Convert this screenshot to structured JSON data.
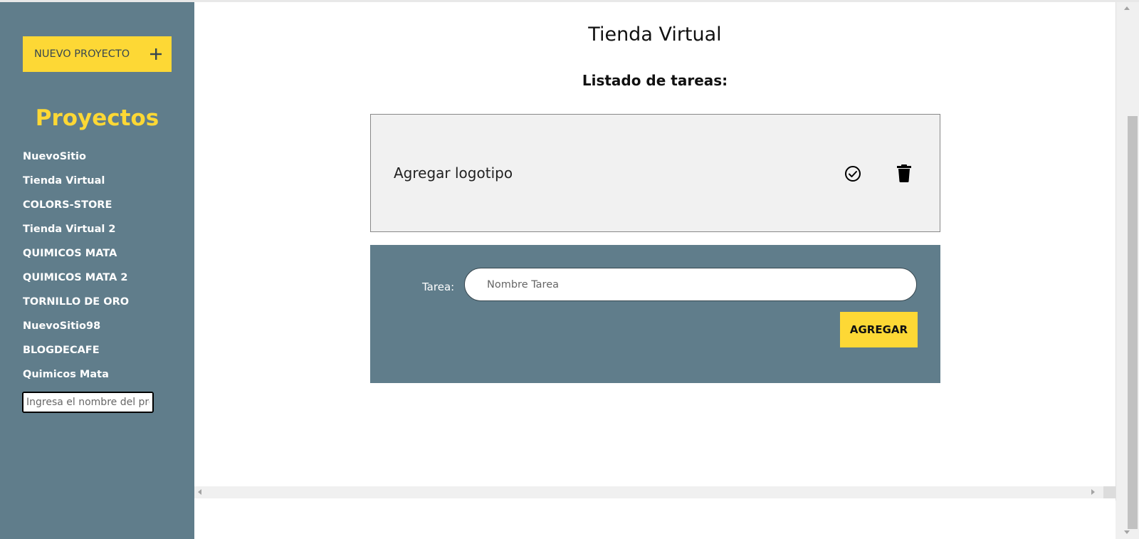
{
  "sidebar": {
    "new_project_label": "NUEVO PROYECTO",
    "new_project_icon": "plus-icon",
    "title": "Proyectos",
    "projects": [
      "NuevoSitio",
      "Tienda Virtual",
      "COLORS-STORE",
      "Tienda Virtual 2",
      "QUIMICOS MATA",
      "QUIMICOS MATA 2",
      "TORNILLO DE ORO",
      "NuevoSitio98",
      "BLOGDECAFE",
      "Quimicos Mata"
    ],
    "project_input_placeholder": "Ingresa el nombre del proyecto"
  },
  "main": {
    "title": "Tienda Virtual",
    "list_title": "Listado de tareas:",
    "tasks": [
      {
        "name": "Agregar logotipo",
        "complete_icon": "check-circle-icon",
        "delete_icon": "trash-icon"
      }
    ],
    "form": {
      "label": "Tarea:",
      "placeholder": "Nombre Tarea",
      "submit_label": "AGREGAR"
    }
  },
  "colors": {
    "sidebar_bg": "#607d8b",
    "accent": "#fdd835",
    "task_bg": "#f1f1f1"
  }
}
